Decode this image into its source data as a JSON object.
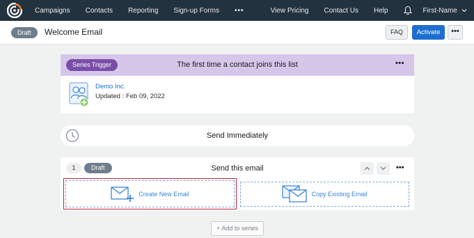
{
  "nav": {
    "items": [
      "Campaigns",
      "Contacts",
      "Reporting",
      "Sign-up Forms"
    ],
    "more": "•••",
    "right_items": [
      "View Pricing",
      "Contact Us",
      "Help"
    ],
    "user": "First-Name"
  },
  "header": {
    "status": "Draft",
    "title": "Welcome Email",
    "faq": "FAQ",
    "activate": "Activate",
    "more": "•••"
  },
  "trigger": {
    "badge": "Series Trigger",
    "text": "The first time a contact joins this list",
    "more": "•••",
    "list_name": "Demo Inc.",
    "updated": "Updated : Feb 09, 2022"
  },
  "send": {
    "text": "Send Immediately"
  },
  "step": {
    "number": "1",
    "status": "Draft",
    "title": "Send this email",
    "more": "•••",
    "create": "Create New Email",
    "copy": "Copy Existing Email"
  },
  "add_series": "+ Add to series",
  "colors": {
    "nav_bg": "#23323f",
    "accent": "#1d6ed0",
    "trigger_bg": "#d6c6ea",
    "trigger_badge": "#7a4ea8",
    "draft_badge": "#6f7e8c",
    "selected_border": "#b1283a"
  },
  "icons": [
    "constant-contact-logo-icon",
    "bell-icon",
    "chevron-down-icon",
    "contacts-list-icon",
    "clock-icon",
    "chevron-up-icon",
    "new-email-icon",
    "copy-email-icon"
  ]
}
